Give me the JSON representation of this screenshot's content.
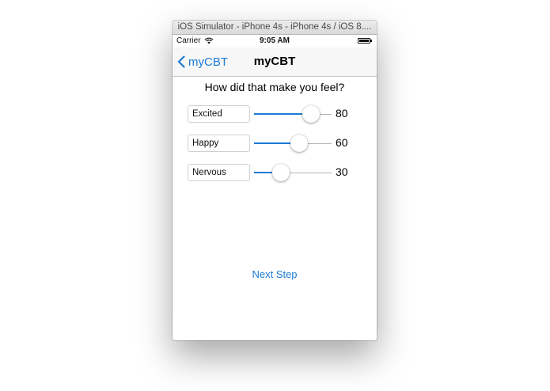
{
  "window": {
    "title": "iOS Simulator - iPhone 4s - iPhone 4s / iOS 8...."
  },
  "status_bar": {
    "carrier": "Carrier",
    "time": "9:05 AM",
    "icons": [
      "wifi-icon",
      "battery-icon"
    ]
  },
  "nav": {
    "back_label": "myCBT",
    "title": "myCBT"
  },
  "content": {
    "question": "How did that make you feel?",
    "emotions": [
      {
        "label": "Excited",
        "value": "80",
        "level": 80
      },
      {
        "label": "Happy",
        "value": "60",
        "level": 60
      },
      {
        "label": "Nervous",
        "value": "30",
        "level": 30
      }
    ],
    "slider_range": [
      0,
      100
    ],
    "next_label": "Next Step"
  },
  "colors": {
    "accent": "#1c7cd5",
    "track": "#b5b5b5"
  }
}
